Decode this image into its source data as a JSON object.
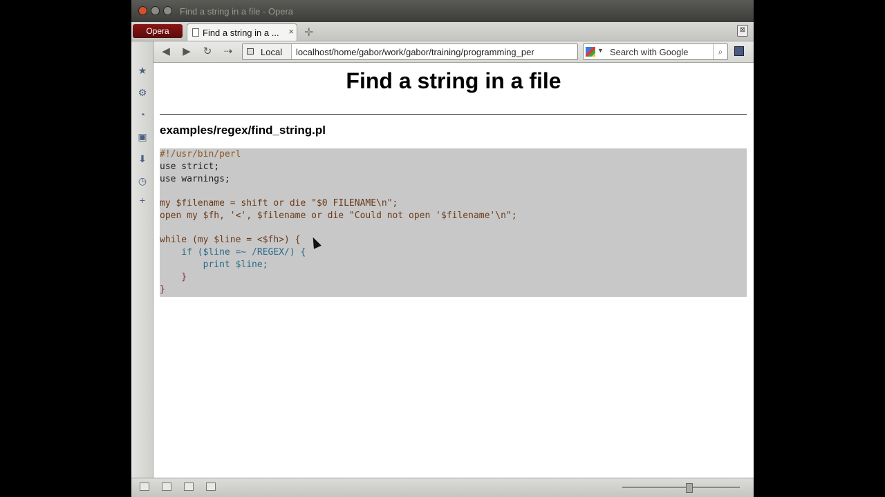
{
  "window": {
    "title": "Find a string in a file - Opera"
  },
  "tabbar": {
    "menu_label": "Opera",
    "tab_label": "Find a string in a ...",
    "tab_close": "×",
    "new_tab": "✛",
    "trash": "⊠"
  },
  "toolbar": {
    "back": "◀",
    "forward": "▶",
    "reload": "↻",
    "speed_dial": "⇢",
    "local_label": "Local",
    "url": "localhost/home/gabor/work/gabor/training/programming_per",
    "search_placeholder": "Search with Google",
    "search_button": "⌕"
  },
  "sidepanel": {
    "icons": [
      "bookmarks-icon",
      "settings-icon",
      "feeds-icon",
      "notes-icon",
      "downloads-icon",
      "history-icon",
      "add-panel-icon"
    ]
  },
  "page": {
    "title": "Find a string in a file",
    "file_path": "examples/regex/find_string.pl",
    "code_lines": [
      "#!/usr/bin/perl",
      "use strict;",
      "use warnings;",
      "",
      "my $filename = shift or die \"$0 FILENAME\\n\";",
      "open my $fh, '<', $filename or die \"Could not open '$filename'\\n\";",
      "",
      "while (my $line = <$fh>) {",
      "    if ($line =~ /REGEX/) {",
      "        print $line;",
      "    }",
      "}"
    ]
  },
  "colors": {
    "code_background": "#c8c8c8",
    "menu_button": "#7a1212"
  }
}
